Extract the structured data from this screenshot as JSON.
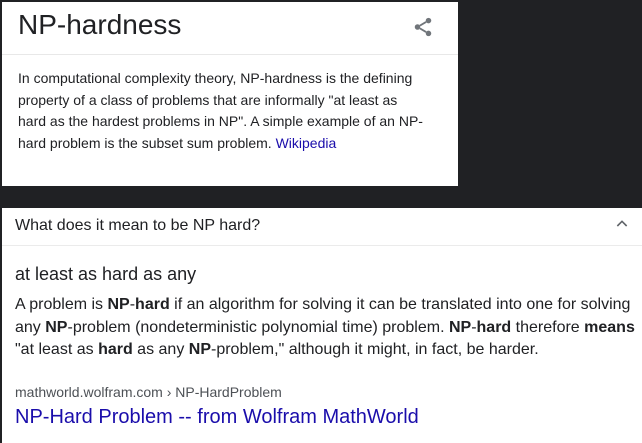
{
  "knowledge_panel": {
    "title": "NP-hardness",
    "share_icon": "share-icon",
    "description": "In computational complexity theory, NP-hardness is the defining property of a class of problems that are informally \"at least as hard as the hardest problems in NP\". A simple example of an NP-hard problem is the subset sum problem. ",
    "source_link": "Wikipedia"
  },
  "qa": {
    "question": "What does it mean to be NP hard?",
    "toggle_icon": "chevron-up-icon",
    "answer_heading": "at least as hard as any",
    "snippet": {
      "s1": "A problem is ",
      "b1": "NP",
      "s2": "-",
      "b2": "hard",
      "s3": " if an algorithm for solving it can be translated into one for solving any ",
      "b3": "NP",
      "s4": "-problem (nondeterministic polynomial time) problem. ",
      "b4": "NP",
      "s5": "-",
      "b5": "hard",
      "s6": " therefore ",
      "b6": "means",
      "s7": " \"at least as ",
      "b7": "hard",
      "s8": " as any ",
      "b8": "NP",
      "s9": "-problem,\" although it might, in fact, be harder."
    },
    "breadcrumb": "mathworld.wolfram.com › NP-HardProblem",
    "result_title": "NP-Hard Problem -- from Wolfram MathWorld"
  },
  "colors": {
    "page_background": "#202124",
    "card_background": "#ffffff",
    "text": "#202124",
    "link": "#1a0dab",
    "secondary_text": "#4d5156",
    "icon": "#70757a"
  }
}
